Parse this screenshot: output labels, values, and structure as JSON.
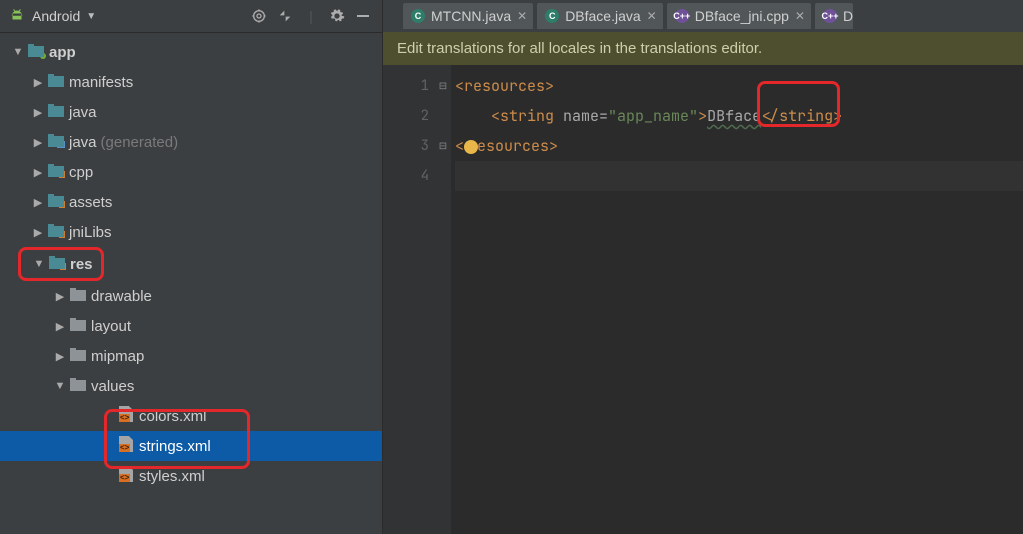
{
  "sidebar": {
    "title": "Android",
    "tree": {
      "app": "app",
      "manifests": "manifests",
      "java": "java",
      "java_gen": "java",
      "java_gen_suffix": "(generated)",
      "cpp": "cpp",
      "assets": "assets",
      "jniLibs": "jniLibs",
      "res": "res",
      "drawable": "drawable",
      "layout": "layout",
      "mipmap": "mipmap",
      "values": "values",
      "colors": "colors.xml",
      "strings": "strings.xml",
      "styles": "styles.xml"
    }
  },
  "tabs": [
    {
      "icon": "java",
      "label": "MTCNN.java"
    },
    {
      "icon": "java",
      "label": "DBface.java"
    },
    {
      "icon": "cpp",
      "label": "DBface_jni.cpp"
    },
    {
      "icon": "cpp",
      "label": "D"
    }
  ],
  "banner": "Edit translations for all locales in the translations editor.",
  "code": {
    "l1_open": "<resources>",
    "l2_pre": "    <string",
    "l2_attrname": " name",
    "l2_eq": "=",
    "l2_val": "\"app_name\"",
    "l2_gt": ">",
    "l2_text": "DBface",
    "l2_close": "</string>",
    "l3_close_pre": "<",
    "l3_close_post": "esources>"
  },
  "lines": [
    "1",
    "2",
    "3",
    "4"
  ]
}
